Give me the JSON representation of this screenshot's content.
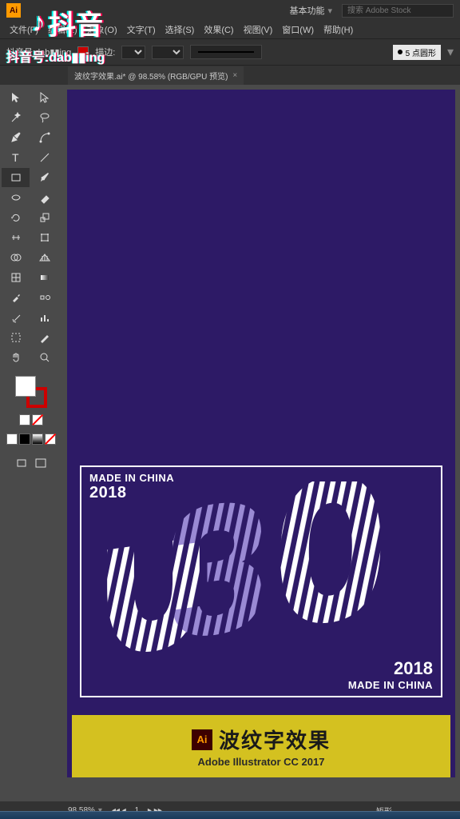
{
  "app": {
    "icon": "Ai",
    "workspace": "基本功能",
    "search_placeholder": "搜索 Adobe Stock"
  },
  "menu": [
    "文件(F)",
    "编辑(E)",
    "对象(O)",
    "文字(T)",
    "选择(S)",
    "效果(C)",
    "视图(V)",
    "窗口(W)",
    "帮助(H)"
  ],
  "control": {
    "account": "抖音号:dab▮▮ing",
    "stroke_label": "描边:",
    "brush_type": "5 点圆形"
  },
  "tab": {
    "title": "波纹字效果.ai* @ 98.58% (RGB/GPU 预览)"
  },
  "poster": {
    "top_label": "MADE IN CHINA",
    "top_year": "2018",
    "bottom_year": "2018",
    "bottom_label": "MADE IN CHINA"
  },
  "banner": {
    "icon": "Ai",
    "title": "波纹字效果",
    "subtitle": "Adobe Illustrator CC 2017"
  },
  "status": {
    "zoom": "98.58%",
    "artboard_nav": "1",
    "right": "矩形"
  },
  "watermark": {
    "logo": "抖音",
    "id": "抖音号:dab▮▮ing"
  }
}
